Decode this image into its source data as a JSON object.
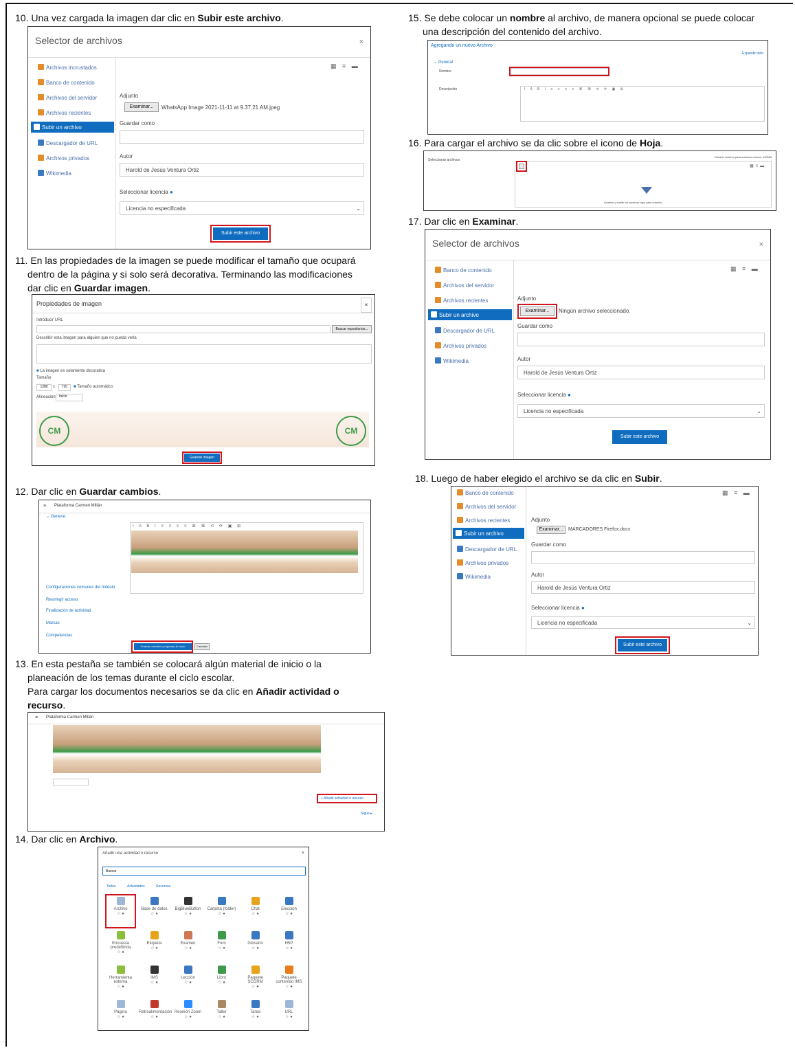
{
  "steps": {
    "s10": {
      "num": "10.",
      "pre": "Una vez cargada la imagen dar clic en ",
      "bold": "Subir este archivo",
      "post": "."
    },
    "s11": {
      "num": "11.",
      "line1": "En las propiedades de la imagen se puede modificar el tamaño que ocupará",
      "line2": "dentro de la página y si solo será decorativa. Terminando las modificaciones",
      "line3_pre": "dar clic en ",
      "bold": "Guardar imagen",
      "post": "."
    },
    "s12": {
      "num": "12.",
      "pre": "Dar clic en ",
      "bold": "Guardar cambios",
      "post": "."
    },
    "s13": {
      "num": "13.",
      "line1": "En esta pestaña se también se colocará algún material de inicio o la",
      "line2": "planeación de los temas durante el ciclo escolar.",
      "line3_pre": "Para cargar los documentos necesarios se da clic en ",
      "bold": "Añadir actividad o",
      "line4_bold": "recurso",
      "post": "."
    },
    "s14": {
      "num": "14.",
      "pre": "Dar clic en ",
      "bold": "Archivo",
      "post": "."
    },
    "s15": {
      "num": "15.",
      "pre": "Se debe colocar un ",
      "bold": "nombre",
      "post": " al archivo, de manera opcional se puede colocar",
      "line2": "una descripción del contenido del archivo."
    },
    "s16": {
      "num": "16.",
      "pre": "Para cargar el archivo se da clic sobre el icono de ",
      "bold": "Hoja",
      "post": "."
    },
    "s17": {
      "num": "17.",
      "pre": "Dar clic en ",
      "bold": "Examinar",
      "post": "."
    },
    "s18": {
      "num": "18.",
      "pre": "Luego de haber elegido el archivo se da clic en ",
      "bold": "Subir",
      "post": "."
    }
  },
  "picker": {
    "title": "Selector de archivos",
    "close": "×",
    "items": [
      "Archivos incrustados",
      "Banco de contenido",
      "Archivos del servidor",
      "Archivos recientes",
      "Subir un archivo",
      "Descargador de URL",
      "Archivos privados",
      "Wikimedia"
    ],
    "adjunto": "Adjunto",
    "examinar": "Examinar...",
    "file1": "WhatsApp Image 2021-11-11 at 9.37.21 AM.jpeg",
    "file2": "Ningún archivo seleccionado.",
    "file3": "MARCADORES Firefox.docx",
    "guardar_como": "Guardar como",
    "autor": "Autor",
    "autor_value": "Harold de Jesús Ventura Ortiz",
    "licencia": "Seleccionar licencia",
    "licencia_value": "Licencia no especificada",
    "subir": "Subir este archivo"
  },
  "img_props": {
    "title": "Propiedades de imagen",
    "url_label": "Introducir URL",
    "search_btn": "Buscar repositorios...",
    "desc_label": "Describir esta imagen para alguien que no pueda verla",
    "decorative": "La imagen es solamente decorativa",
    "size_label": "Tamaño",
    "w": "1280",
    "h": "720",
    "auto": "Tamaño automático",
    "align_label": "Alineación",
    "align_value": "Inicio",
    "save": "Guardar imagen"
  },
  "course_edit": {
    "brand": "Plataforma Carmen Millán",
    "general": "General",
    "sections": [
      "Configuraciones comunes del módulo",
      "Restringir acceso",
      "Finalización de actividad",
      "Marcas",
      "Competencias"
    ],
    "save_btn": "Guardar cambios y regresar al curso",
    "cancel": "Cancelar"
  },
  "course_view": {
    "brand": "Plataforma Carmen Millán",
    "add": "Añadir actividad o recurso",
    "next": "Sigue"
  },
  "activity_chooser": {
    "title": "Añadir una actividad o recurso",
    "search": "Buscar",
    "tabs": [
      "Todos",
      "Actividades",
      "Recursos"
    ],
    "items": [
      "Archivo",
      "Base de datos",
      "BigBlueButton",
      "Carpeta (folder)",
      "Chat",
      "Elección",
      "Encuesta predefinida",
      "Etiqueta",
      "Examen",
      "Foro",
      "Glosario",
      "H5P",
      "Herramienta externa",
      "IMS",
      "Lección",
      "Libro",
      "Paquete SCORM",
      "Paquete contenido IMS",
      "Página",
      "Retroalimentación",
      "Reunión Zoom",
      "Taller",
      "Tarea",
      "URL"
    ]
  },
  "new_file": {
    "title": "Agregando un nuevo Archivo",
    "general": "General",
    "nombre": "Nombre",
    "descripcion": "Descripción",
    "expand": "Expandir todo"
  },
  "select_files": {
    "label": "Seleccionar archivos",
    "max": "Tamaño máximo para archivos nuevos: 100MB",
    "drop": "Arrastre y suelte los archivos aquí para subirlos"
  }
}
